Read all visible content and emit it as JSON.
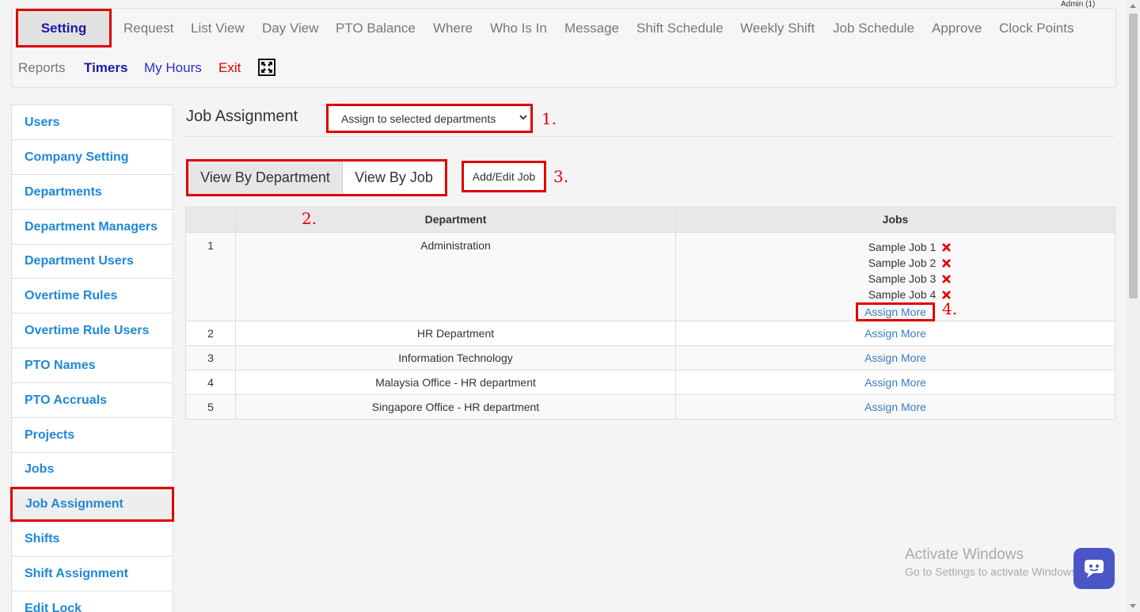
{
  "header": {
    "admin_label": "Admin (1)"
  },
  "topnav": {
    "items": [
      {
        "label": "Setting"
      },
      {
        "label": "Request"
      },
      {
        "label": "List View"
      },
      {
        "label": "Day View"
      },
      {
        "label": "PTO Balance"
      },
      {
        "label": "Where"
      },
      {
        "label": "Who Is In"
      },
      {
        "label": "Message"
      },
      {
        "label": "Shift Schedule"
      },
      {
        "label": "Weekly Shift"
      },
      {
        "label": "Job Schedule"
      },
      {
        "label": "Approve"
      },
      {
        "label": "Clock Points"
      },
      {
        "label": "Reports"
      },
      {
        "label": "Timers"
      },
      {
        "label": "My Hours"
      },
      {
        "label": "Exit"
      }
    ],
    "expand_icon": "fullscreen-icon",
    "colors": {
      "setting_label": "#1a1aa6",
      "timers": "#1a1aa6",
      "my_hours": "#2a2ad0",
      "exit": "#e00000",
      "inactive": "#777777"
    }
  },
  "sidebar": {
    "items": [
      {
        "label": "Users"
      },
      {
        "label": "Company Setting"
      },
      {
        "label": "Departments"
      },
      {
        "label": "Department Managers"
      },
      {
        "label": "Department Users"
      },
      {
        "label": "Overtime Rules"
      },
      {
        "label": "Overtime Rule Users"
      },
      {
        "label": "PTO Names"
      },
      {
        "label": "PTO Accruals"
      },
      {
        "label": "Projects"
      },
      {
        "label": "Jobs"
      },
      {
        "label": "Job Assignment"
      },
      {
        "label": "Shifts"
      },
      {
        "label": "Shift Assignment"
      },
      {
        "label": "Edit Lock"
      }
    ],
    "active": "Job Assignment",
    "link_color": "#1e88d8"
  },
  "main": {
    "title": "Job Assignment",
    "assign_mode": {
      "selected": "Assign to selected departments"
    },
    "view_toggle": {
      "by_department": "View By Department",
      "by_job": "View By Job"
    },
    "add_edit_button": "Add/Edit Job",
    "callouts": {
      "c1": "1.",
      "c2": "2.",
      "c3": "3.",
      "c4": "4."
    },
    "table": {
      "headers": {
        "num": "",
        "department": "Department",
        "jobs": "Jobs"
      },
      "rows": [
        {
          "num": "1",
          "department": "Administration",
          "jobs": [
            "Sample Job 1",
            "Sample Job 2",
            "Sample Job 3",
            "Sample Job 4"
          ],
          "assign_label": "Assign More"
        },
        {
          "num": "2",
          "department": "HR Department",
          "assign_label": "Assign More"
        },
        {
          "num": "3",
          "department": "Information Technology",
          "assign_label": "Assign More"
        },
        {
          "num": "4",
          "department": "Malaysia Office - HR department",
          "assign_label": "Assign More"
        },
        {
          "num": "5",
          "department": "Singapore Office - HR department",
          "assign_label": "Assign More"
        }
      ],
      "remove_icon": "x-remove-icon",
      "remove_color": "#e00000",
      "link_color": "#3a7cc3"
    }
  },
  "watermark": {
    "line1": "Activate Windows",
    "line2": "Go to Settings to activate Windows."
  },
  "chat": {
    "icon": "chat-bubble-icon",
    "color": "#4a56c6"
  },
  "highlight_color": "#e00000"
}
